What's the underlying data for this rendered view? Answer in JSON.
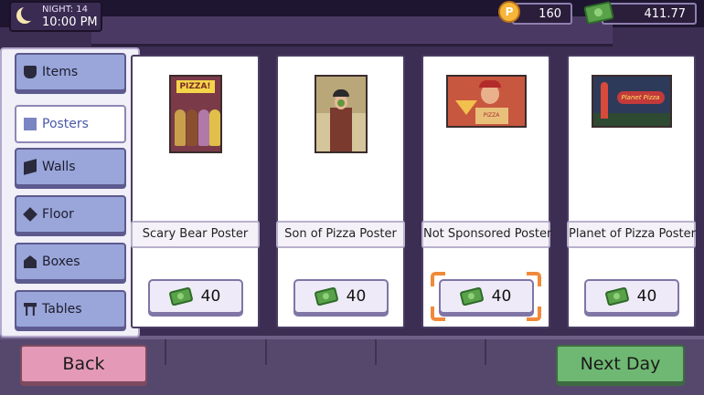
{
  "hud": {
    "night_label": "NIGHT: 14",
    "time": "10:00 PM",
    "coins": "160",
    "money": "411.77"
  },
  "categories": [
    {
      "label": "Items",
      "icon": "plant-pot-icon",
      "active": false
    },
    {
      "label": "Posters",
      "icon": "picture-icon",
      "active": true
    },
    {
      "label": "Walls",
      "icon": "wall-icon",
      "active": false
    },
    {
      "label": "Floor",
      "icon": "floor-tile-icon",
      "active": false
    },
    {
      "label": "Boxes",
      "icon": "box-icon",
      "active": false
    },
    {
      "label": "Tables",
      "icon": "table-icon",
      "active": false
    }
  ],
  "posters": [
    {
      "name": "Scary Bear Poster",
      "price": "40",
      "art_text": "PIZZA!"
    },
    {
      "name": "Son of Pizza Poster",
      "price": "40"
    },
    {
      "name": "Not Sponsored Poster",
      "price": "40",
      "art_text": "PIZZA",
      "selected": true
    },
    {
      "name": "Planet of Pizza Poster",
      "price": "40",
      "art_text": "Planet Pizza"
    }
  ],
  "buttons": {
    "back": "Back",
    "next_day": "Next Day"
  },
  "colors": {
    "selection_highlight": "#f08a3a",
    "back_button": "#e49ab6",
    "next_button": "#6fb873"
  }
}
